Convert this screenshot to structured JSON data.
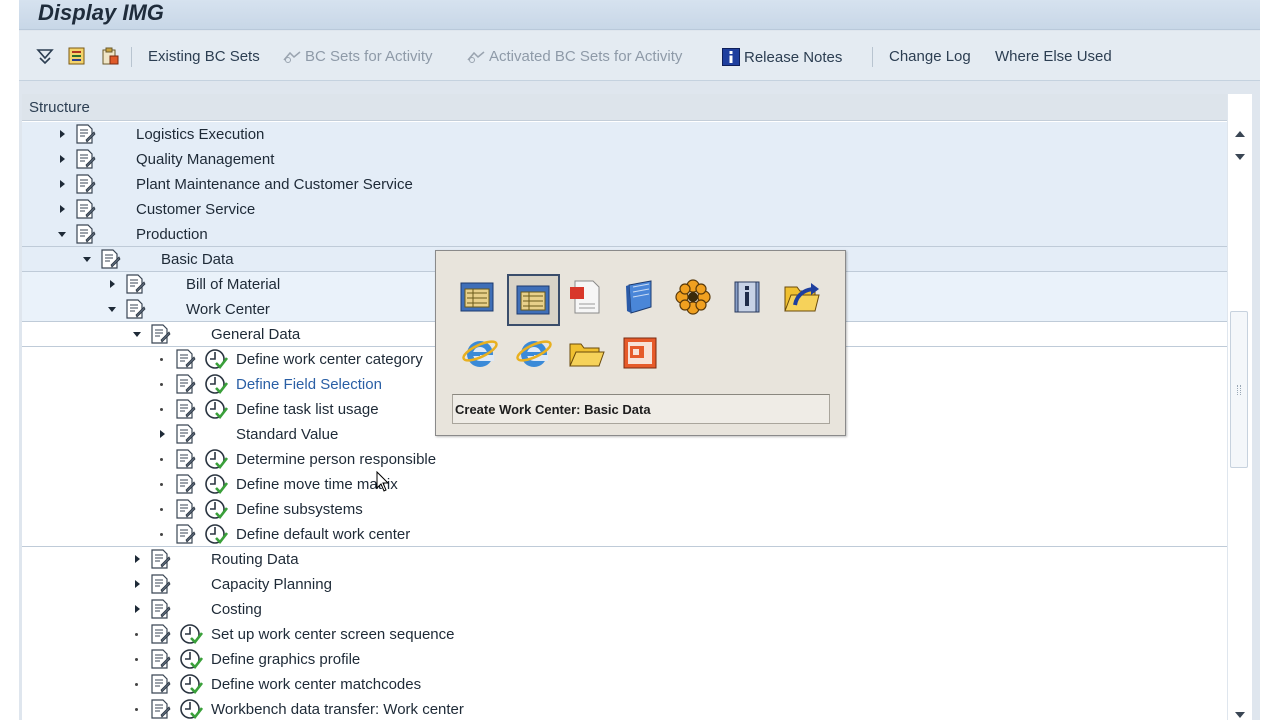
{
  "window": {
    "title": "Display IMG"
  },
  "toolbar": {
    "buttons": [
      {
        "label": "Existing BC Sets",
        "enabled": true
      },
      {
        "label": "BC Sets for Activity",
        "enabled": false
      },
      {
        "label": "Activated BC Sets for Activity",
        "enabled": false
      },
      {
        "label": "Release Notes",
        "enabled": true
      },
      {
        "label": "Change Log",
        "enabled": true
      },
      {
        "label": "Where Else Used",
        "enabled": true
      }
    ]
  },
  "structure": {
    "header": "Structure",
    "nodes": [
      {
        "label": "Logistics Execution",
        "expander": "collapsed"
      },
      {
        "label": "Quality Management",
        "expander": "collapsed"
      },
      {
        "label": "Plant Maintenance and Customer Service",
        "expander": "collapsed"
      },
      {
        "label": "Customer Service",
        "expander": "collapsed"
      },
      {
        "label": "Production",
        "expander": "expanded"
      },
      {
        "label": "Basic Data",
        "expander": "expanded"
      },
      {
        "label": "Bill of Material",
        "expander": "collapsed"
      },
      {
        "label": "Work Center",
        "expander": "expanded"
      },
      {
        "label": "General Data",
        "expander": "expanded"
      },
      {
        "label": "Define work center category",
        "expander": "leaf"
      },
      {
        "label": "Define Field Selection",
        "expander": "leaf"
      },
      {
        "label": "Define task list usage",
        "expander": "leaf"
      },
      {
        "label": "Standard Value",
        "expander": "collapsed"
      },
      {
        "label": "Determine person responsible",
        "expander": "leaf"
      },
      {
        "label": "Define move time matrix",
        "expander": "leaf"
      },
      {
        "label": "Define subsystems",
        "expander": "leaf"
      },
      {
        "label": "Define default work center",
        "expander": "leaf"
      },
      {
        "label": "Routing Data",
        "expander": "collapsed"
      },
      {
        "label": "Capacity Planning",
        "expander": "collapsed"
      },
      {
        "label": "Costing",
        "expander": "collapsed"
      },
      {
        "label": "Set up work center screen sequence",
        "expander": "leaf"
      },
      {
        "label": "Define graphics profile",
        "expander": "leaf"
      },
      {
        "label": "Define work center matchcodes",
        "expander": "leaf"
      },
      {
        "label": "Workbench data transfer: Work center",
        "expander": "leaf"
      }
    ]
  },
  "popup": {
    "caption": "Create Work Center: Basic Data",
    "icons": [
      "transaction-icon",
      "transaction-selected-icon",
      "pdf-document-icon",
      "notepad-icon",
      "flower-icon",
      "info-book-icon",
      "folder-arrow-icon",
      "internet-explorer-icon",
      "internet-explorer-icon-2",
      "folder-icon",
      "powerpoint-icon"
    ]
  },
  "colors": {
    "highlight_band": "#e4edf7",
    "link": "#2a5fa5",
    "toolbar_bg": "#e4ebf2"
  }
}
